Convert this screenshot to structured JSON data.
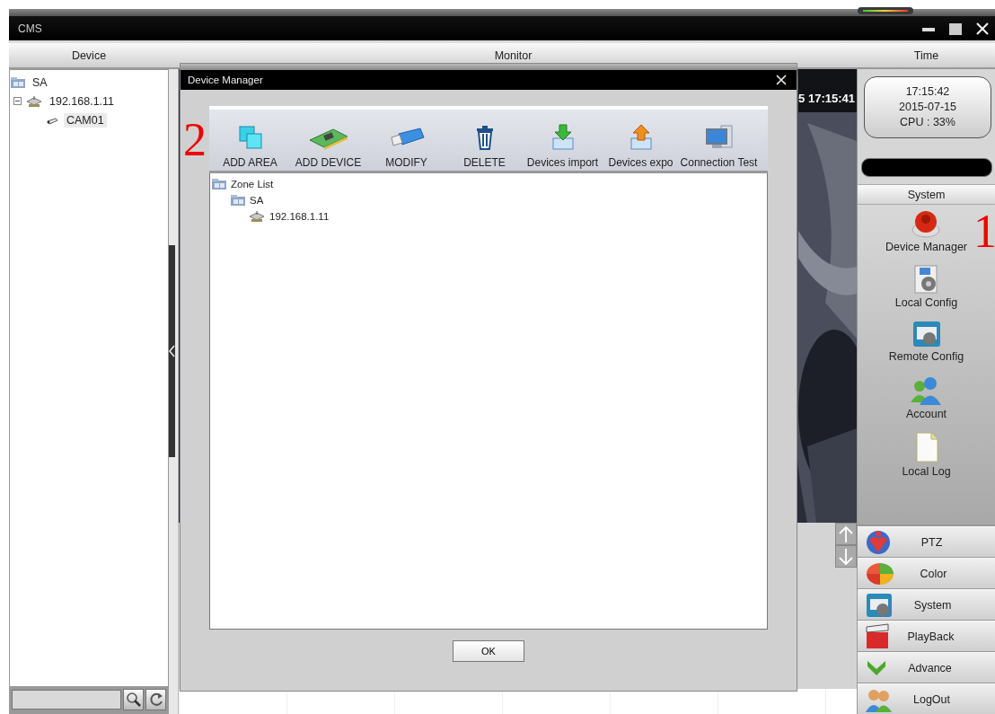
{
  "window": {
    "title": "CMS"
  },
  "headers": [
    {
      "label": "Device"
    },
    {
      "label": "Monitor"
    },
    {
      "label": "Time"
    }
  ],
  "device_tree": [
    {
      "label": "SA",
      "kind": "zone",
      "selected": false,
      "children": [
        {
          "label": "192.168.1.11",
          "kind": "device",
          "selected": false,
          "expanded": true,
          "children": [
            {
              "label": "CAM01",
              "kind": "camera",
              "selected": true
            }
          ]
        }
      ]
    }
  ],
  "video": {
    "timestamp": "5 17:15:41"
  },
  "clock": {
    "time": "17:15:42",
    "date": "2015-07-15",
    "cpu": "CPU : 33%"
  },
  "system_panel": {
    "title": "System",
    "items": [
      {
        "label": "Device Manager"
      },
      {
        "label": "Local Config"
      },
      {
        "label": "Remote Config"
      },
      {
        "label": "Account"
      },
      {
        "label": "Local Log"
      }
    ]
  },
  "nav_buttons": [
    {
      "label": "PTZ"
    },
    {
      "label": "Color"
    },
    {
      "label": "System"
    },
    {
      "label": "PlayBack"
    },
    {
      "label": "Advance"
    },
    {
      "label": "LogOut"
    }
  ],
  "dialog": {
    "title": "Device Manager",
    "toolbar": [
      {
        "label": "ADD AREA"
      },
      {
        "label": "ADD DEVICE"
      },
      {
        "label": "MODIFY"
      },
      {
        "label": "DELETE"
      },
      {
        "label": "Devices import"
      },
      {
        "label": "Devices expo"
      },
      {
        "label": "Connection  Test"
      }
    ],
    "tree": [
      {
        "label": "Zone List",
        "kind": "zone",
        "children": [
          {
            "label": "SA",
            "kind": "zone",
            "children": [
              {
                "label": "192.168.1.11",
                "kind": "device"
              }
            ]
          }
        ]
      }
    ],
    "ok_button": "OK"
  },
  "annotations": [
    {
      "label": "1"
    },
    {
      "label": "2"
    }
  ]
}
